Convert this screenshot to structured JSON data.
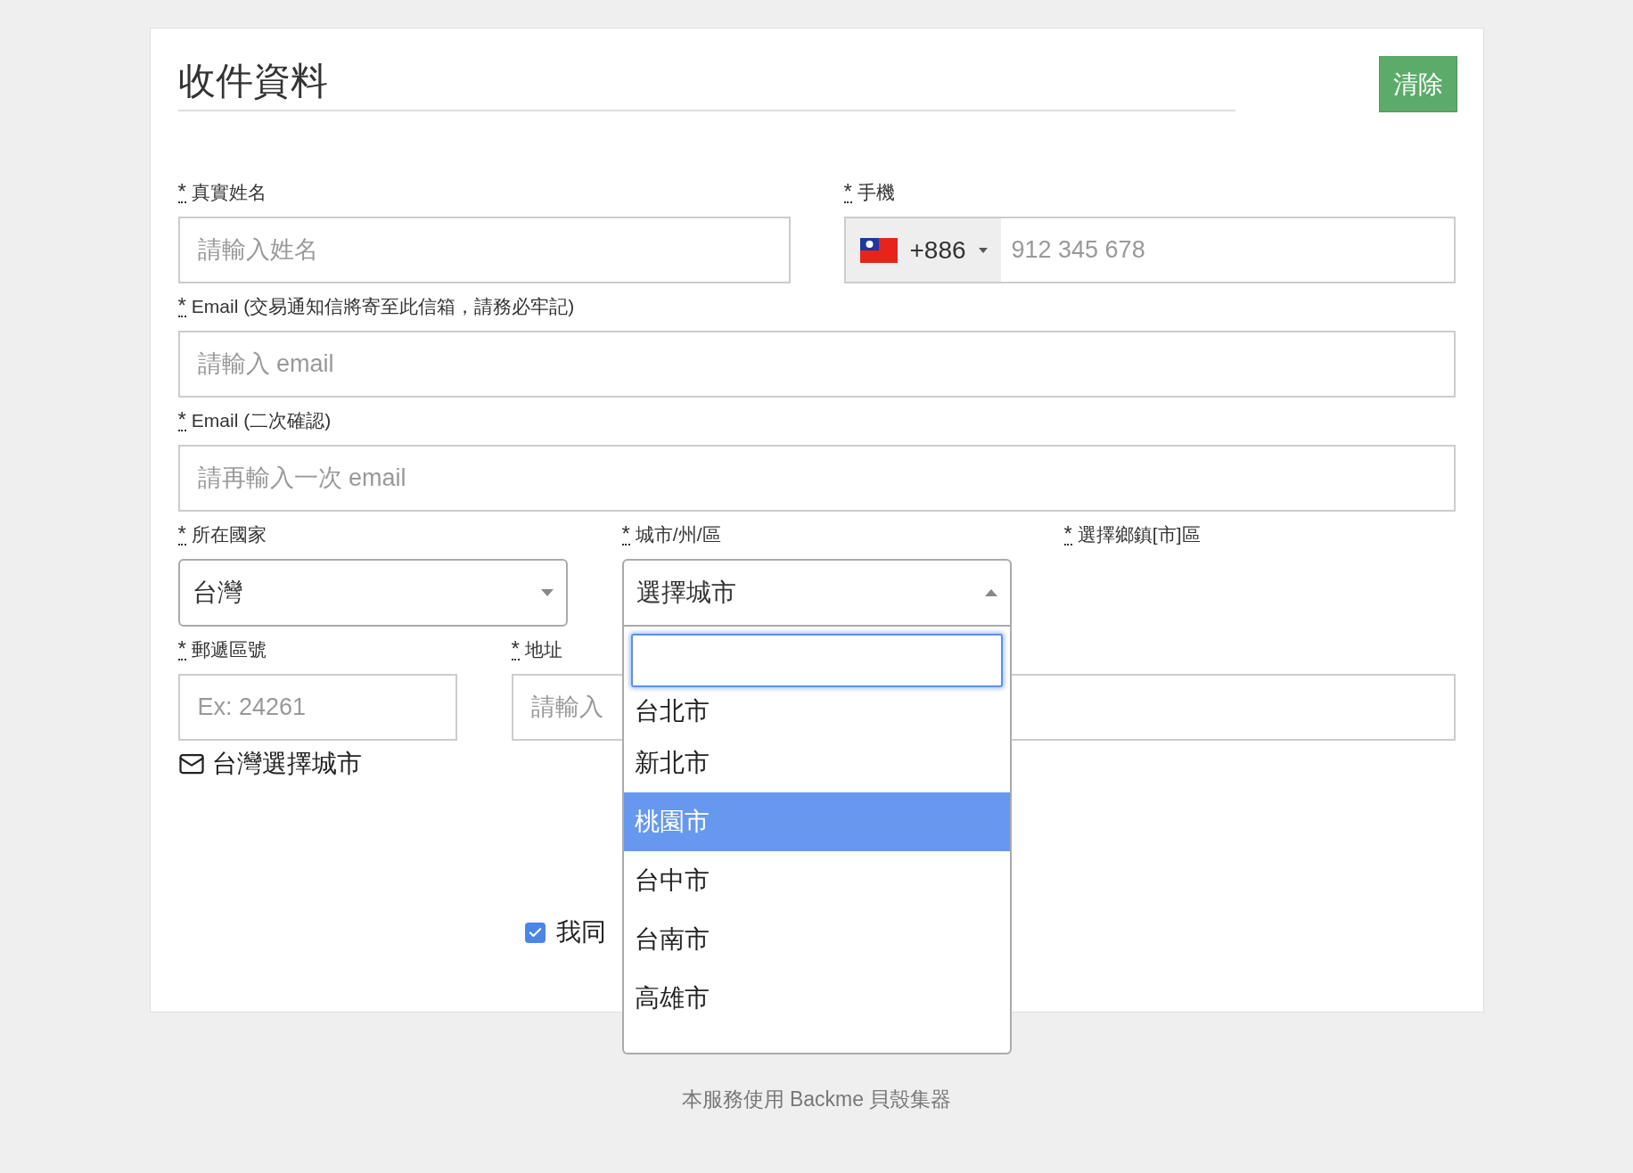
{
  "title": "收件資料",
  "clear_button": "清除",
  "name_field": {
    "mark": "*",
    "label": "真實姓名",
    "placeholder": "請輸入姓名"
  },
  "phone_field": {
    "mark": "*",
    "label": "手機",
    "country_code": "+886",
    "placeholder": "912 345 678"
  },
  "email_field": {
    "mark": "*",
    "label": "Email (交易通知信將寄至此信箱，請務必牢記)",
    "placeholder": "請輸入 email"
  },
  "email_confirm_field": {
    "mark": "*",
    "label": "Email (二次確認)",
    "placeholder": "請再輸入一次 email"
  },
  "country_field": {
    "mark": "*",
    "label": "所在國家",
    "value": "台灣"
  },
  "city_field": {
    "mark": "*",
    "label": "城市/州/區",
    "value": "選擇城市",
    "expanded": true,
    "options": [
      {
        "label": "台北市",
        "selected": false
      },
      {
        "label": "新北市",
        "selected": false
      },
      {
        "label": "桃園市",
        "selected": true
      },
      {
        "label": "台中市",
        "selected": false
      },
      {
        "label": "台南市",
        "selected": false
      },
      {
        "label": "高雄市",
        "selected": false
      }
    ]
  },
  "district_field": {
    "mark": "*",
    "label": "選擇鄉鎮[市]區"
  },
  "postal_field": {
    "mark": "*",
    "label": "郵遞區號",
    "placeholder": "Ex: 24261"
  },
  "address_field": {
    "mark": "*",
    "label": "地址",
    "placeholder": "請輸入"
  },
  "postal_hint": "台灣選擇城市",
  "agreement": {
    "label": "我同",
    "checked": true
  },
  "footer": "本服務使用 Backme 貝殼集器"
}
